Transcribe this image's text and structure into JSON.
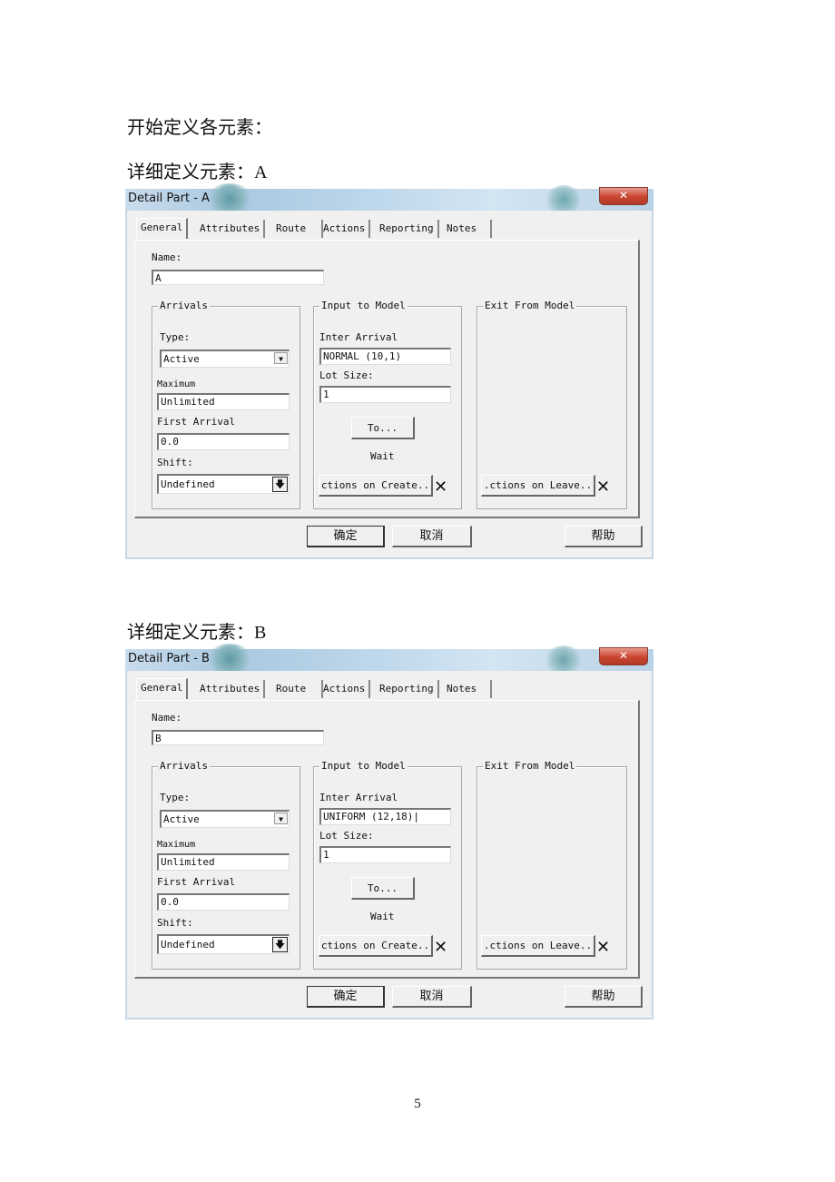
{
  "doc": {
    "para1": "开始定义各元素：",
    "para2": "详细定义元素：A",
    "para3": "详细定义元素：B",
    "page_number": "5"
  },
  "dialogs": [
    {
      "title": "Detail Part - A",
      "close_glyph": "✕",
      "tabs": [
        "General",
        "Attributes",
        "Route",
        "Actions",
        "Reporting",
        "Notes"
      ],
      "name_label": "Name:",
      "name_value": "A",
      "arrivals": {
        "legend": "Arrivals",
        "type_label": "Type:",
        "type_value": "Active",
        "maximum_label": "Maximum",
        "maximum_value": "Unlimited",
        "first_arrival_label": "First Arrival",
        "first_arrival_value": "0.0",
        "shift_label": "Shift:",
        "shift_value": "Undefined"
      },
      "input": {
        "legend": "Input to Model",
        "inter_arrival_label": "Inter Arrival",
        "inter_arrival_value": "NORMAL (10,1)",
        "lot_size_label": "Lot Size:",
        "lot_size_value": "1",
        "to_button": "To...",
        "wait_label": "Wait",
        "actions_on_create": "ctions on Create..",
        "clear_glyph": "✕"
      },
      "exit": {
        "legend": "Exit From Model",
        "actions_on_leave": ".ctions on Leave..",
        "clear_glyph": "✕"
      },
      "buttons": {
        "ok": "确定",
        "cancel": "取消",
        "help": "帮助"
      }
    },
    {
      "title": "Detail Part - B",
      "close_glyph": "✕",
      "tabs": [
        "General",
        "Attributes",
        "Route",
        "Actions",
        "Reporting",
        "Notes"
      ],
      "name_label": "Name:",
      "name_value": "B",
      "arrivals": {
        "legend": "Arrivals",
        "type_label": "Type:",
        "type_value": "Active",
        "maximum_label": "Maximum",
        "maximum_value": "Unlimited",
        "first_arrival_label": "First Arrival",
        "first_arrival_value": "0.0",
        "shift_label": "Shift:",
        "shift_value": "Undefined"
      },
      "input": {
        "legend": "Input to Model",
        "inter_arrival_label": "Inter Arrival",
        "inter_arrival_value": "UNIFORM (12,18)|",
        "lot_size_label": "Lot Size:",
        "lot_size_value": "1",
        "to_button": "To...",
        "wait_label": "Wait",
        "actions_on_create": "ctions on Create..",
        "clear_glyph": "✕"
      },
      "exit": {
        "legend": "Exit From Model",
        "actions_on_leave": ".ctions on Leave..",
        "clear_glyph": "✕"
      },
      "buttons": {
        "ok": "确定",
        "cancel": "取消",
        "help": "帮助"
      }
    }
  ]
}
